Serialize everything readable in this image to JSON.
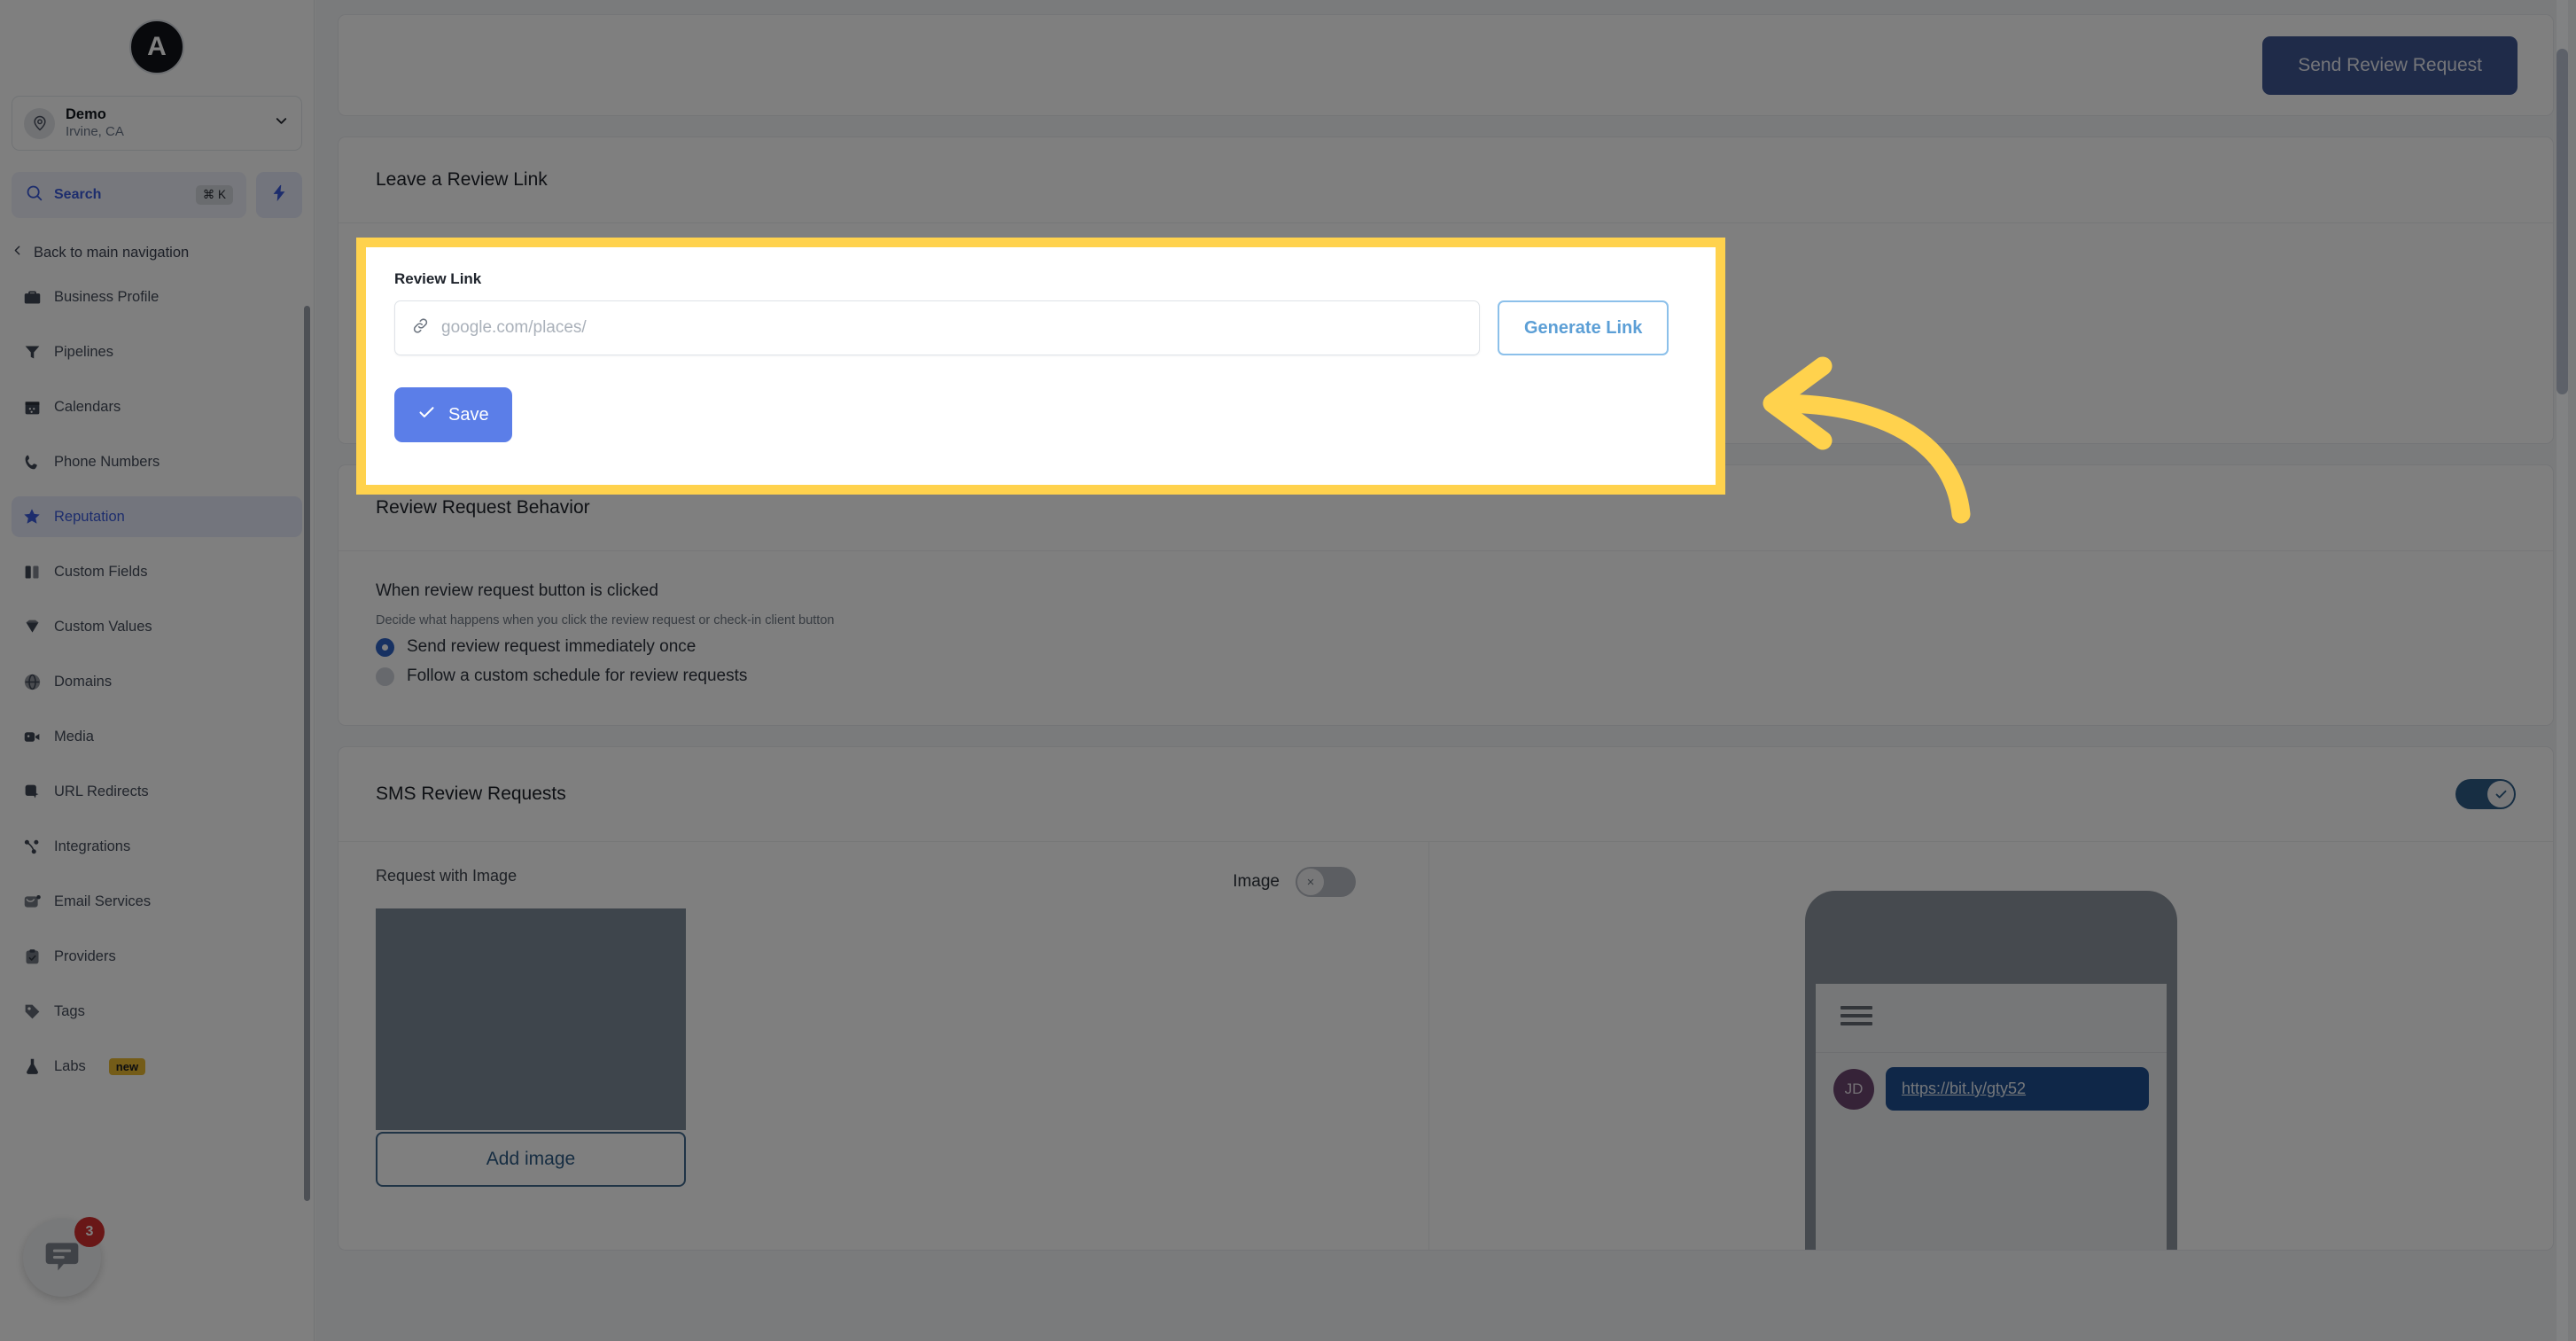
{
  "sidebar": {
    "logo_letter": "A",
    "location": {
      "name": "Demo",
      "sublabel": "Irvine, CA"
    },
    "search": {
      "label": "Search",
      "shortcut": "⌘ K"
    },
    "back_nav_label": "Back to main navigation",
    "items": [
      {
        "label": "Business Profile",
        "icon": "briefcase-icon",
        "active": false
      },
      {
        "label": "Pipelines",
        "icon": "funnel-icon",
        "active": false
      },
      {
        "label": "Calendars",
        "icon": "calendar-icon",
        "active": false
      },
      {
        "label": "Phone Numbers",
        "icon": "phone-icon",
        "active": false
      },
      {
        "label": "Reputation",
        "icon": "star-icon",
        "active": true
      },
      {
        "label": "Custom Fields",
        "icon": "columns-icon",
        "active": false
      },
      {
        "label": "Custom Values",
        "icon": "gem-icon",
        "active": false
      },
      {
        "label": "Domains",
        "icon": "globe-icon",
        "active": false
      },
      {
        "label": "Media",
        "icon": "video-icon",
        "active": false
      },
      {
        "label": "URL Redirects",
        "icon": "pointer-icon",
        "active": false
      },
      {
        "label": "Integrations",
        "icon": "nodes-icon",
        "active": false
      },
      {
        "label": "Email Services",
        "icon": "mail-icon",
        "active": false
      },
      {
        "label": "Providers",
        "icon": "clipboard-check-icon",
        "active": false
      },
      {
        "label": "Tags",
        "icon": "tag-icon",
        "active": false
      },
      {
        "label": "Labs",
        "icon": "flask-icon",
        "active": false,
        "badge": "new"
      }
    ],
    "chat": {
      "unread_count": "3",
      "icon": "chat-bubble-icon"
    }
  },
  "topbar": {
    "send_review_request_label": "Send Review Request"
  },
  "review_link_section": {
    "title": "Leave a Review Link",
    "field_label": "Review Link",
    "input_value": "",
    "input_placeholder": "google.com/places/",
    "input_icon": "link-icon",
    "generate_link_label": "Generate Link",
    "save_label": "Save",
    "save_icon": "check-icon",
    "highlight_color": "#ffd24d"
  },
  "behavior_section": {
    "title": "Review Request Behavior",
    "sub_label": "When review request button is clicked",
    "hint": "Decide what happens when you click the review request or check-in client button",
    "options": [
      {
        "label": "Send review request immediately once",
        "selected": true
      },
      {
        "label": "Follow a custom schedule for review requests",
        "selected": false
      }
    ]
  },
  "sms_section": {
    "title": "SMS Review Requests",
    "enabled": true,
    "request_with_image_label": "Request with Image",
    "image_toggle_label": "Image",
    "image_toggle_on": false,
    "image_toggle_glyph": "×",
    "add_image_label": "Add image",
    "preview": {
      "avatar_initials": "JD",
      "message_link": "https://bit.ly/gty52",
      "menu_icon": "hamburger-icon"
    }
  },
  "annotation": {
    "arrow_color": "#ffd24d",
    "arrow_icon": "curved-arrow-left-icon"
  }
}
